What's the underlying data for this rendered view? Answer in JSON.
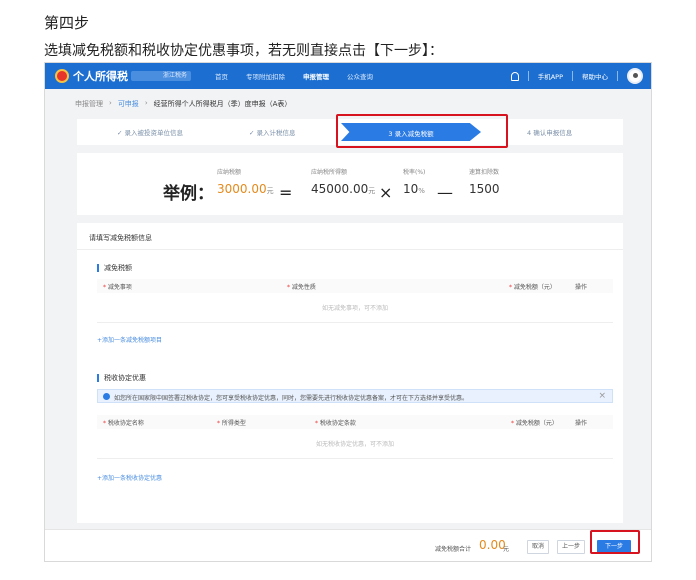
{
  "article": {
    "step_heading": "第四步",
    "instruction": "选填减免税额和税收协定优惠事项，若无则直接点击【下一步】："
  },
  "topbar": {
    "logo_text": "个人所得税",
    "region": "浙江税务",
    "nav": [
      "首页",
      "专项附加扣除",
      "申报管理",
      "公众查询"
    ],
    "active_nav": "申报管理",
    "mobile_app": "手机APP",
    "help_center": "帮助中心",
    "icons": [
      "bell-icon",
      "avatar"
    ],
    "brand_color": "#1c6fd1"
  },
  "breadcrumb": [
    "申报管理",
    "可申报",
    "经营所得个人所得税月（季）度申报（A表）"
  ],
  "steps": [
    {
      "label": "✓ 录入被投资单位信息",
      "state": "done"
    },
    {
      "label": "✓ 录入计税信息",
      "state": "done"
    },
    {
      "label": "3 录入减免税额",
      "state": "active"
    },
    {
      "label": "4 确认申报信息",
      "state": "pending"
    }
  ],
  "example": {
    "title": "举例：",
    "tax_payable": {
      "label": "应纳税额",
      "value": "3000.00",
      "unit": "元"
    },
    "equals": "=",
    "taxable_income": {
      "label": "应纳税所得额",
      "value": "45000.00",
      "unit": "元"
    },
    "times": "×",
    "tax_rate": {
      "label": "税率(%)",
      "value": "10",
      "unit": "%"
    },
    "minus": "—",
    "quick_deduction": {
      "label": "速算扣除数",
      "value": "1500"
    }
  },
  "form": {
    "header": "请填写减免税额信息",
    "reduction": {
      "title": "减免税额",
      "columns": [
        "减免事项",
        "减免性质",
        "减免税额（元）",
        "操作"
      ],
      "empty": "如无减免事项，可不添加",
      "add_link": "+添加一条减免税额项目"
    },
    "treaty": {
      "title": "税收协定优惠",
      "notice": "如您所在国家限中国签署过税收协定，您可享受税收协定优惠，同时，您需要先进行税收协定优惠备案，才可在下方选择并享受优惠。",
      "columns": [
        "税收协定名称",
        "所得类型",
        "税收协定条款",
        "减免税额（元）",
        "操作"
      ],
      "empty": "如无税收协定优惠，可不添加",
      "add_link": "+添加一条税收协定优惠"
    }
  },
  "footer": {
    "total_label": "减免税额合计",
    "total_value": "0.00",
    "total_unit": "元",
    "cancel": "取消",
    "prev": "上一步",
    "next": "下一步"
  }
}
